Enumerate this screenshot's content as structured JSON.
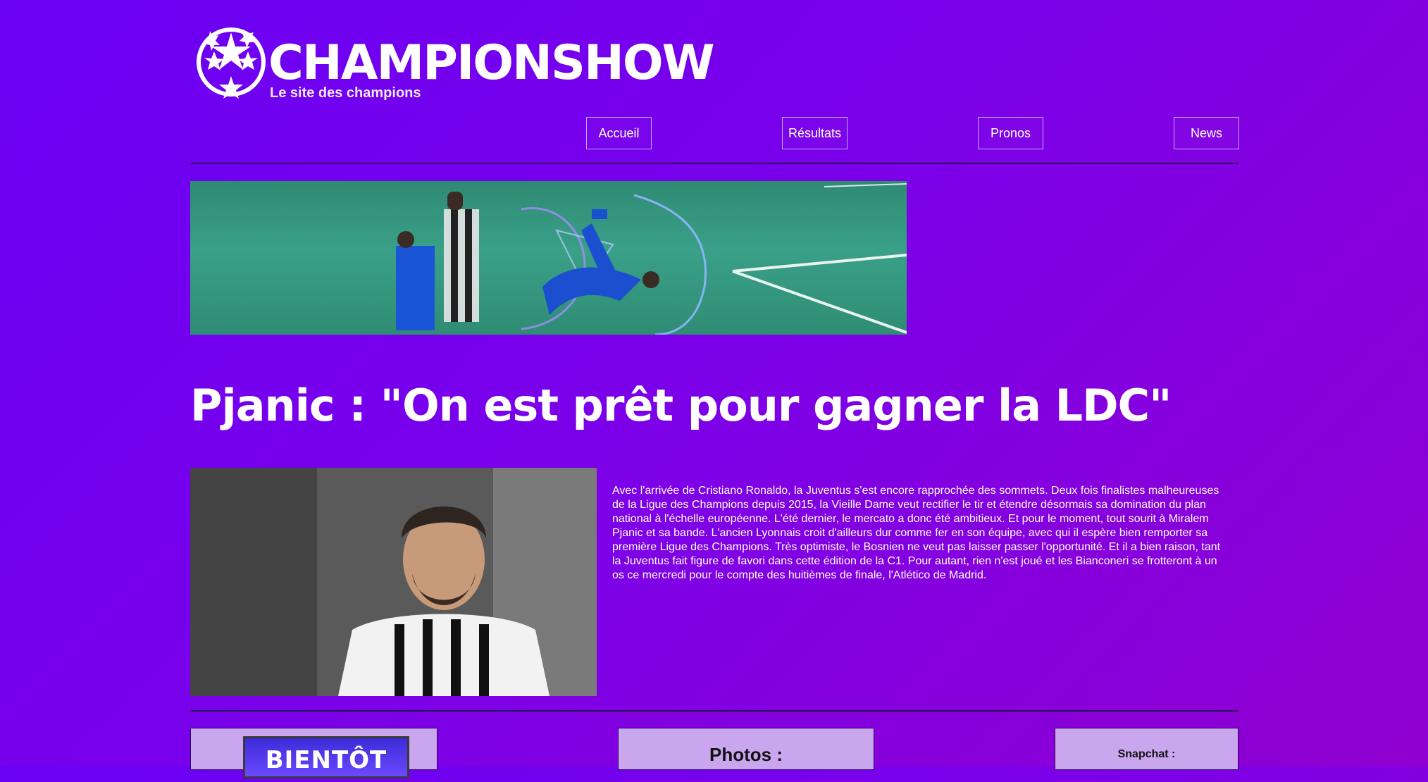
{
  "header": {
    "brand": "CHAMPIONSHOW",
    "tagline": "Le site des champions"
  },
  "nav": {
    "items": [
      {
        "label": "Accueil"
      },
      {
        "label": "Résultats"
      },
      {
        "label": "Pronos"
      },
      {
        "label": "News"
      }
    ]
  },
  "article": {
    "headline": "Pjanic : \"On est prêt pour gagner la LDC\"",
    "body": "Avec l'arrivée de Cristiano Ronaldo, la Juventus s'est encore rapprochée des sommets. Deux fois finalistes malheureuses de la Ligue des Champions depuis 2015, la Vieille Dame veut rectifier le tir et étendre désormais sa domination du plan national à l'échelle européenne. L'été dernier, le mercato a donc été ambitieux. Et pour le moment, tout sourit à Miralem Pjanic et sa bande. L'ancien Lyonnais croit d'ailleurs dur comme fer en son équipe, avec qui il espère bien remporter sa première Ligue des Champions. Très optimiste, le Bosnien ne veut pas laisser passer l'opportunité. Et il a bien raison, tant la Juventus fait figure de favori dans cette édition de la C1. Pour autant, rien n'est joué et les Bianconeri se frotteront à un os ce mercredi pour le compte des huitièmes de finale, l'Atlético de Madrid."
  },
  "bottom": {
    "soon_label": "BIENTÔT",
    "photos_title": "Photos :",
    "snapchat_title": "Snapchat :"
  },
  "colors": {
    "background_start": "#6a00f4",
    "background_end": "#9000d0",
    "card_bg": "#c9a6ee"
  },
  "icons": {
    "logo": "starball-icon"
  }
}
